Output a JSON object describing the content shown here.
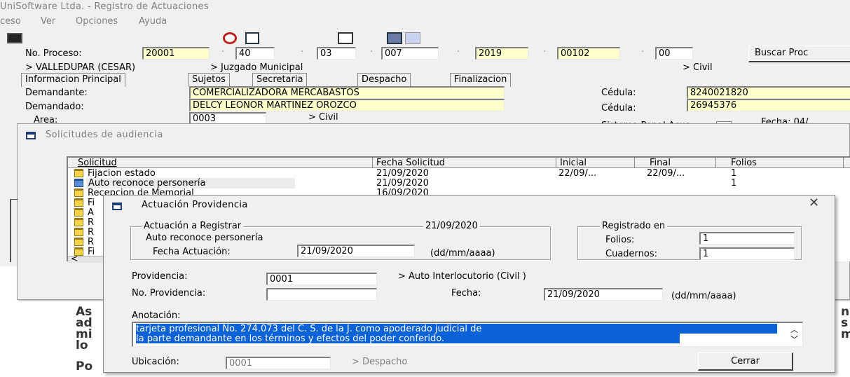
{
  "window": {
    "title": "UniSoftware Ltda. - Registro de Actuaciones"
  },
  "menu": [
    {
      "label": "ceso"
    },
    {
      "label": "Ver"
    },
    {
      "label": "Opciones"
    },
    {
      "label": "Ayuda"
    }
  ],
  "proceso": {
    "label": "No. Proceso:",
    "parts": [
      "20001",
      "40",
      "03",
      "007",
      "2019",
      "00102",
      "00"
    ],
    "search_label": "Buscar Proc"
  },
  "location": {
    "city": "> VALLEDUPAR (CESAR)",
    "court": "> Juzgado Municipal",
    "specialty": "> Civil"
  },
  "tabs": [
    {
      "label": "Informacion Principal"
    },
    {
      "label": "Sujetos"
    },
    {
      "label": "Secretaria"
    },
    {
      "label": "Despacho"
    },
    {
      "label": "Finalizacion"
    }
  ],
  "main": {
    "demandante_label": "Demandante:",
    "demandante": "COMERCIALIZADORA MERCABASTOS",
    "cedula1_label": "Cédula:",
    "cedula1": "8240021820",
    "demandado_label": "Demandado:",
    "demandado": "DELCY LEONOR MARTINEZ OROZCO",
    "cedula2_label": "Cédula:",
    "cedula2": "26945376",
    "area_label": "Area:",
    "area_code": "0003",
    "area_name": "> Civil",
    "sistema_label": "Sistema Penal Acus",
    "fecha_label": "Fecha: 04/"
  },
  "solicitudes": {
    "title": "Solicitudes de audiencia",
    "columns": [
      "Solicitud",
      "Fecha Solicitud",
      "Inicial",
      "Final",
      "Folios"
    ],
    "rows": [
      {
        "solicitud": "Fijacion estado",
        "fecha": "21/09/2020",
        "inicial": "22/09/...",
        "final": "22/09/...",
        "folios": "1"
      },
      {
        "solicitud": "Auto reconoce personería",
        "fecha": "21/09/2020",
        "inicial": "",
        "final": "",
        "folios": "1"
      },
      {
        "solicitud": "Recepcion de Memorial",
        "fecha": "16/09/2020",
        "inicial": "",
        "final": "",
        "folios": ""
      }
    ],
    "partial_rows": [
      "Fi",
      "A",
      "R",
      "R",
      "R",
      "Fi"
    ]
  },
  "dialog": {
    "title": "Actuación Providencia",
    "actuacion_group": "Actuación a Registrar",
    "actuacion_date": "21/09/2020",
    "actuacion_name": "Auto reconoce personería",
    "fecha_actuacion_label": "Fecha Actuación:",
    "fecha_actuacion": "21/09/2020",
    "date_format": "(dd/mm/aaaa)",
    "registrado_group": "Registrado en",
    "folios_label": "Folios:",
    "folios": "1",
    "cuadernos_label": "Cuadernos:",
    "cuadernos": "1",
    "providencia_label": "Providencia:",
    "providencia": "0001",
    "providencia_desc": "> Auto Interlocutorio (Civil )",
    "no_providencia_label": "No. Providencia:",
    "no_providencia": "",
    "fecha_label": "Fecha:",
    "fecha": "21/09/2020",
    "fecha_format": "(dd/mm/aaaa)",
    "anotacion_label": "Anotación:",
    "anotacion_line1": "tarjeta profesional No. 274.073 del C. S. de la J. como  apoderado  judicial  de",
    "anotacion_line2": " la  parte demandante en los términos y efectos del poder conferido.",
    "ubicacion_label": "Ubicación:",
    "ubicacion": "0001",
    "ubicacion_desc": "> Despacho",
    "cerrar_label": "Cerrar"
  },
  "background_doc": {
    "lines": [
      "As",
      "ad",
      "mi",
      "lo",
      "Po"
    ],
    "right_fragments": [
      "n",
      "s",
      "m"
    ]
  },
  "colors": {
    "selection": "#0a62d6",
    "yellow_field": "#ffffcc",
    "window_bg": "#f0f0f0"
  }
}
